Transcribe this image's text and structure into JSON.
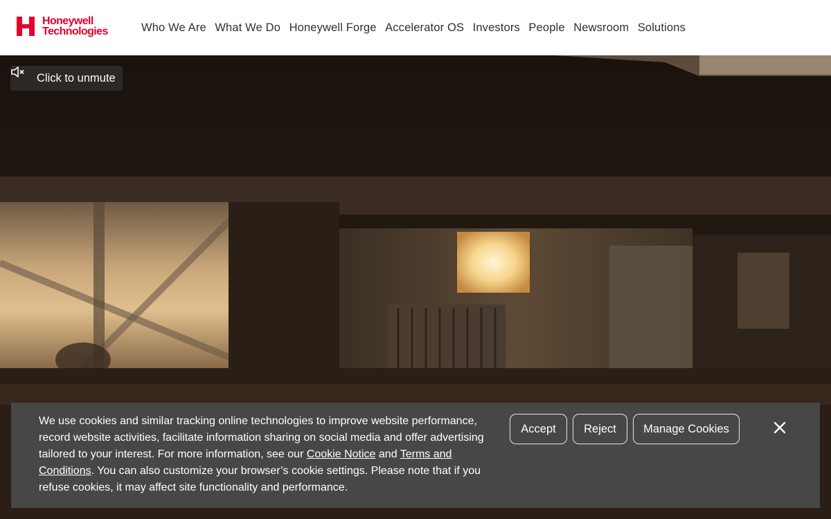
{
  "brand": {
    "line1": "Honeywell",
    "line2": "Technologies",
    "color": "#e4002b",
    "logo_icon": "honeywell-h-icon"
  },
  "nav": {
    "items": [
      {
        "label": "Who We Are"
      },
      {
        "label": "What We Do"
      },
      {
        "label": "Honeywell Forge"
      },
      {
        "label": "Accelerator OS"
      },
      {
        "label": "Investors"
      },
      {
        "label": "People"
      },
      {
        "label": "Newsroom"
      },
      {
        "label": "Solutions"
      }
    ]
  },
  "hero": {
    "unmute_label": "Click to unmute",
    "unmute_icon": "speaker-muted-icon"
  },
  "cookie": {
    "text_1": "We use cookies and similar tracking online technologies to improve website performance, record website activities, facilitate information sharing on social media and offer advertising tailored to your interest. For more information, see our ",
    "link_notice": "Cookie Notice",
    "text_2": " and ",
    "link_terms": "Terms and Conditions",
    "text_3": ". You can also customize your browser’s cookie settings. Please note that if you refuse cookies, it may affect site functionality and performance.",
    "accept_label": "Accept",
    "reject_label": "Reject",
    "manage_label": "Manage Cookies",
    "close_icon": "close-icon",
    "background": "#484848"
  }
}
